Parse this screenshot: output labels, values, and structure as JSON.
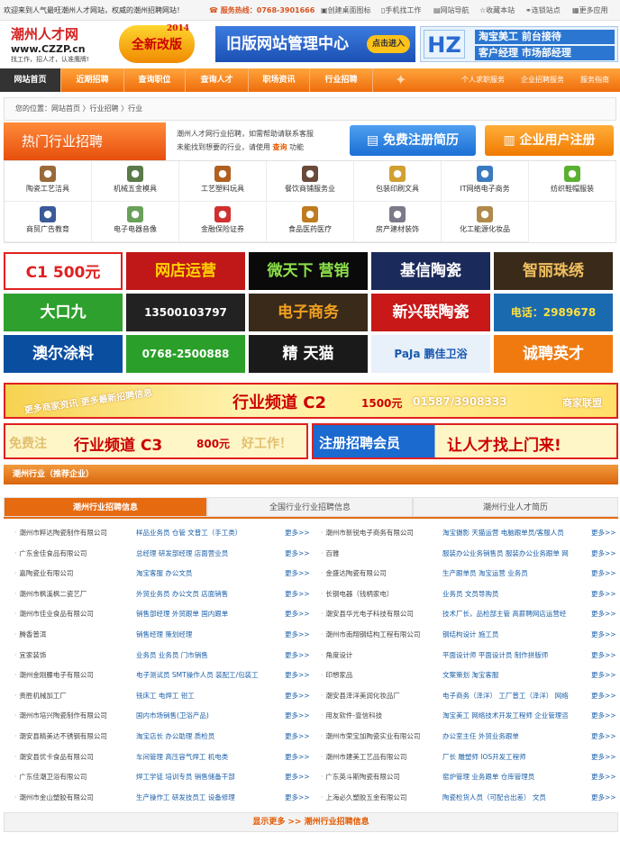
{
  "topbar": {
    "welcome": "欢迎来到人气最旺潮州人才网站，权威的潮州招聘网站！",
    "hotline_label": "服务热线：",
    "hotline": "0768-3901666",
    "links": [
      "创建桌面图标",
      "手机找工作",
      "网站导航",
      "收藏本站",
      "连锁站点",
      "更多应用"
    ]
  },
  "logo": {
    "cn": "潮州人才网",
    "en": "www.CZZP.cn",
    "slogan": "找工作，招人才，认准鹰牌!"
  },
  "badge": {
    "text": "全新改版",
    "year": "2014"
  },
  "banner_old": {
    "text": "旧版网站管理中心",
    "enter": "点击进入"
  },
  "banner_right": {
    "logo": "HZ",
    "line1": "淘宝美工  前台接待",
    "line2": "客户经理  市场部经理"
  },
  "nav": {
    "items": [
      "网站首页",
      "近期招聘",
      "查询职位",
      "查询人才",
      "职场资讯",
      "行业招聘"
    ],
    "right": [
      "个人求职服务",
      "企业招聘服务",
      "服务指南"
    ]
  },
  "breadcrumb": "您的位置：网站首页 〉行业招聘 〉行业",
  "hot": {
    "title": "热门行业招聘",
    "desc1": "潮州人才网行业招聘，如需帮助请联系客服",
    "desc2": "未能找到想要的行业，请使用",
    "query": "查询",
    "desc3": "功能",
    "btn_reg": "免费注册简历",
    "btn_ent": "企业用户注册"
  },
  "categories": [
    {
      "label": "陶瓷工艺洁具",
      "icon": "cup-icon",
      "color": "#9a6a3a"
    },
    {
      "label": "机械五金模具",
      "icon": "truck-icon",
      "color": "#5a7a4a"
    },
    {
      "label": "工艺塑料玩具",
      "icon": "bear-icon",
      "color": "#b06020"
    },
    {
      "label": "餐饮商铺服务业",
      "icon": "chef-icon",
      "color": "#6a4a3a"
    },
    {
      "label": "包装印刷文具",
      "icon": "pencil-icon",
      "color": "#d0a030"
    },
    {
      "label": "IT网络电子商务",
      "icon": "computer-icon",
      "color": "#3a7ac0"
    },
    {
      "label": "纺织鞋帽服装",
      "icon": "shirt-icon",
      "color": "#5ab030"
    },
    {
      "label": "商贸广告教育",
      "icon": "book-icon",
      "color": "#3a5a9a"
    },
    {
      "label": "电子电器音像",
      "icon": "chip-icon",
      "color": "#6aa05a"
    },
    {
      "label": "金融保险证券",
      "icon": "medkit-icon",
      "color": "#d03030"
    },
    {
      "label": "食品医药医疗",
      "icon": "bottle-icon",
      "color": "#c07a20"
    },
    {
      "label": "房产建材装饰",
      "icon": "gear-icon",
      "color": "#7a7a8a"
    },
    {
      "label": "化工能源化妆品",
      "icon": "house-icon",
      "color": "#b08a4a"
    }
  ],
  "ads": [
    {
      "text": "C1 500元",
      "bg": "#ffffff",
      "fg": "#e02020"
    },
    {
      "text": "网店运营",
      "bg": "#c01818",
      "fg": "#ffd400"
    },
    {
      "text": "微天下 营销",
      "bg": "#0a0a0a",
      "fg": "#8de04a"
    },
    {
      "text": "基信陶瓷",
      "bg": "#1a2a5a",
      "fg": "#ffffff"
    },
    {
      "text": "智丽珠绣",
      "bg": "#3a2a1a",
      "fg": "#f0c060"
    },
    {
      "text": "大口九",
      "bg": "#2ea02e",
      "fg": "#ffffff"
    },
    {
      "text": "13500103797",
      "bg": "#222222",
      "fg": "#ffffff"
    },
    {
      "text": "电子商务",
      "bg": "#3a2a1a",
      "fg": "#f0a020"
    },
    {
      "text": "新兴联陶瓷",
      "bg": "#c81818",
      "fg": "#ffffff"
    },
    {
      "text": "电话：2989678",
      "bg": "#1a6ab0",
      "fg": "#ffe040"
    },
    {
      "text": "澳尔涂料",
      "bg": "#0a4ea0",
      "fg": "#ffffff"
    },
    {
      "text": "0768-2500888",
      "bg": "#2aa02a",
      "fg": "#ffffff"
    },
    {
      "text": "精 天猫",
      "bg": "#1a1a1a",
      "fg": "#ffffff"
    },
    {
      "text": "PaJa 鹏佳卫浴",
      "bg": "#e8f0fa",
      "fg": "#1a5ab0"
    },
    {
      "text": "诚聘英才",
      "bg": "#f07a10",
      "fg": "#ffffff"
    }
  ],
  "wide_c2": {
    "left": "更多商家资讯 更多最新招聘信息",
    "main": "行业频道 C2",
    "price": "1500元",
    "right": "商家联盟",
    "phone": "01587/3908333"
  },
  "wide_c3": {
    "left": "免费注",
    "main": "行业频道 C3",
    "price": "800元",
    "mid": "好工作！"
  },
  "wide_reg": {
    "btn": "注册招聘会员",
    "slogan": "让人才找上门来!"
  },
  "section": {
    "title": "潮州行业（推荐企业）"
  },
  "tabs": [
    "潮州行业招聘信息",
    "全国行业行业招聘信息",
    "潮州行业人才简历"
  ],
  "more_label": "更多>>",
  "left_rows": [
    {
      "co": "潮州市粹达陶瓷制作有限公司",
      "jb": "样品业务员 仓管 文普工（手工类）"
    },
    {
      "co": "广东金佳食品有限公司",
      "jb": "总经理 研发部经理 店面营业员"
    },
    {
      "co": "嘉陶瓷业有限公司",
      "jb": "淘宝客服 办公文员"
    },
    {
      "co": "潮州市枫溪枫二瓷艺厂",
      "jb": "外贸业务员 办公文员 店面销售"
    },
    {
      "co": "潮州市佳业食品有限公司",
      "jb": "销售部经理 外贸跟单 国内跟单"
    },
    {
      "co": "腾香普洱",
      "jb": "销售经理 策划经理"
    },
    {
      "co": "宜家装饰",
      "jb": "业务员 业务员 门市销售"
    },
    {
      "co": "潮州金刚腰电子有限公司",
      "jb": "电子测试员 SMT操作人员 装配工/包装工"
    },
    {
      "co": "贵胜机械加工厂",
      "jb": "铣床工 电焊工 钳工"
    },
    {
      "co": "潮州市培兴陶瓷制作有限公司",
      "jb": "国内市场销售(卫浴产品)"
    },
    {
      "co": "潮安县精美达不锈钢有限公司",
      "jb": "淘宝店长 办公助理 质检员"
    },
    {
      "co": "潮安县优卡食品有限公司",
      "jb": "车间管理 高压容气焊工 机电类"
    },
    {
      "co": "广东佳潮卫浴有限公司",
      "jb": "焊工学徒 培训专员 销售储备干部"
    },
    {
      "co": "潮州市金山塑胶有限公司",
      "jb": "生产操作工 研发技员工 设备修理"
    }
  ],
  "right_rows": [
    {
      "co": "潮州市新锐电子商务有限公司",
      "jb": "淘宝摄影 天猫运营 电脑跟单员/客服人员"
    },
    {
      "co": "百雅",
      "jb": "服装办公业务销售员 服装办公业务跟单 网"
    },
    {
      "co": "金盛达陶瓷有限公司",
      "jb": "生产跟单员 淘宝运营 业务员"
    },
    {
      "co": "长钢电器（钱柄家电）",
      "jb": "业务员 文员导购员"
    },
    {
      "co": "潮安县华光电子科技有限公司",
      "jb": "技术厂长，品检部主管 高薪聘网店运营经"
    },
    {
      "co": "潮州市南翔钢结构工程有限公司",
      "jb": "钢结构设计 施工员"
    },
    {
      "co": "角度设计",
      "jb": "平面设计师 平面设计员 制作拼版师"
    },
    {
      "co": "印想家品",
      "jb": "文案策划 淘宝客服"
    },
    {
      "co": "潮安县泽洋美润化妆品厂",
      "jb": "电子商务（泽洋） 工厂普工（泽洋） 网络"
    },
    {
      "co": "用友软件-壹信科技",
      "jb": "淘宝美工 网络技术开发工程师 企业管理咨"
    },
    {
      "co": "潮州市荣宝加陶瓷实业有限公司",
      "jb": "办公室主任 外贸业务跟单"
    },
    {
      "co": "潮州市建美工艺品有限公司",
      "jb": "厂长 雕塑师 IOS开发工程师"
    },
    {
      "co": "广东英斗斯陶瓷有限公司",
      "jb": "窑炉管理 业务跟单 仓库管理员"
    },
    {
      "co": "上海必久塑胶五金有限公司",
      "jb": "陶瓷检货人员（可配合出差） 文员"
    }
  ],
  "footer": {
    "more": "显示更多 >>",
    "title": "潮州行业招聘信息"
  }
}
